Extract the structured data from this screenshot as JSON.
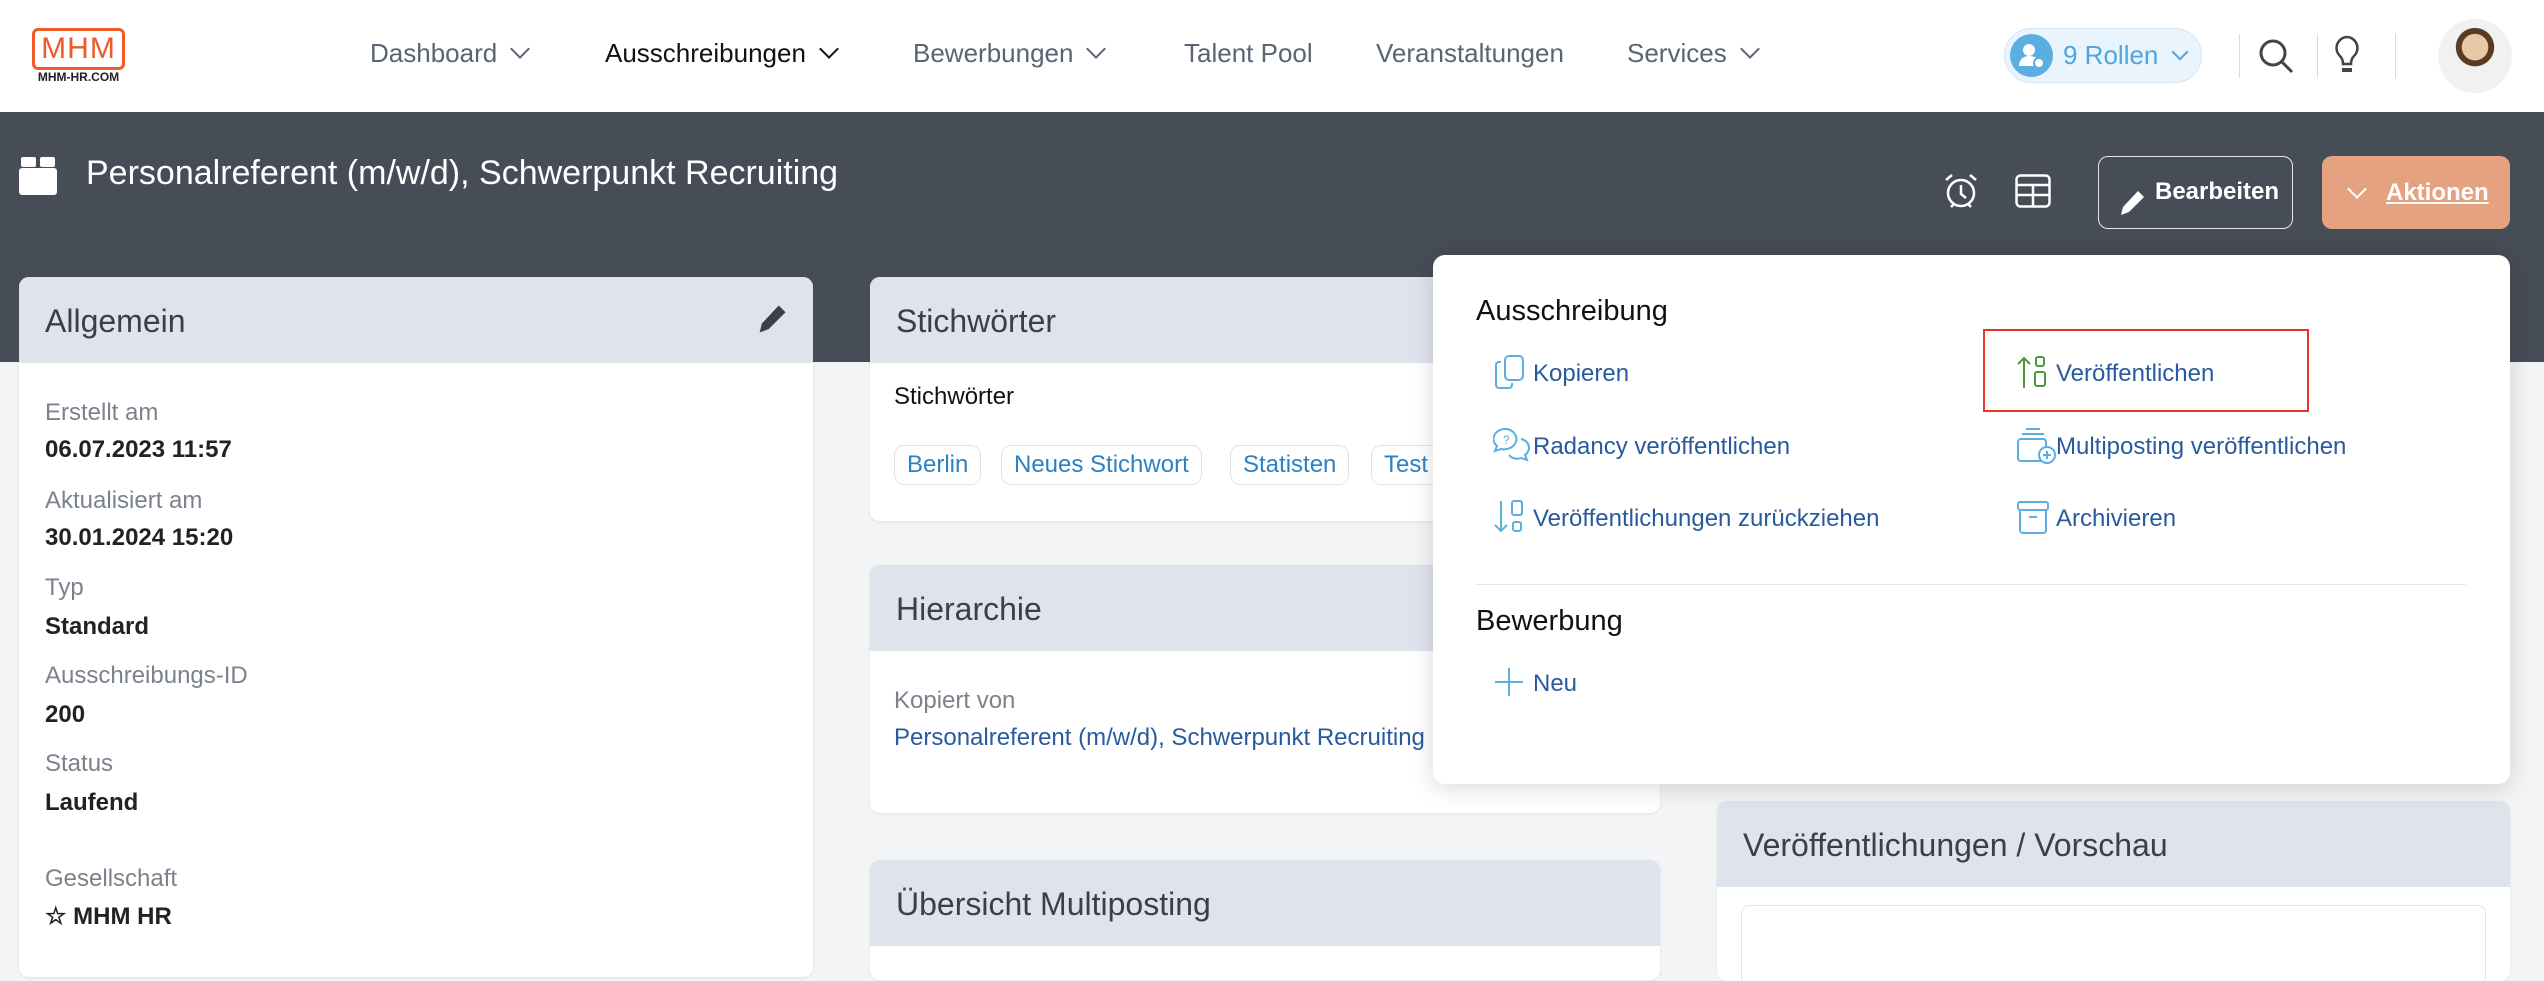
{
  "header": {
    "logo_text": "MHM",
    "logo_sub": "MHM-HR.COM",
    "nav": [
      {
        "label": "Dashboard",
        "dropdown": true
      },
      {
        "label": "Ausschreibungen",
        "dropdown": true,
        "active": true
      },
      {
        "label": "Bewerbungen",
        "dropdown": true
      },
      {
        "label": "Talent Pool"
      },
      {
        "label": "Veranstaltungen"
      },
      {
        "label": "Services",
        "dropdown": true
      }
    ],
    "roles_label": "9 Rollen",
    "icons": [
      "search-icon",
      "lightbulb-icon"
    ]
  },
  "page": {
    "title": "Personalreferent (m/w/d), Schwerpunkt Recruiting",
    "edit_label": "Bearbeiten",
    "actions_label": "Aktionen",
    "accent": "#e5a280"
  },
  "allgemein": {
    "title": "Allgemein",
    "fields": [
      {
        "label": "Erstellt am",
        "value": "06.07.2023 11:57"
      },
      {
        "label": "Aktualisiert am",
        "value": "30.01.2024 15:20"
      },
      {
        "label": "Typ",
        "value": "Standard"
      },
      {
        "label": "Ausschreibungs-ID",
        "value": "200"
      },
      {
        "label": "Status",
        "value": "Laufend"
      },
      {
        "label": "Gesellschaft",
        "value": "☆ MHM HR"
      }
    ]
  },
  "stichwoerter": {
    "title": "Stichwörter",
    "label": "Stichwörter",
    "tags": [
      "Berlin",
      "Neues Stichwort",
      "Statisten",
      "Test"
    ]
  },
  "hierarchie": {
    "title": "Hierarchie",
    "label": "Kopiert von",
    "link": "Personalreferent (m/w/d), Schwerpunkt Recruiting"
  },
  "multiposting": {
    "title": "Übersicht Multiposting"
  },
  "vorschau": {
    "title": "Veröffentlichungen / Vorschau"
  },
  "actions_menu": {
    "section1": "Ausschreibung",
    "items": [
      "Kopieren",
      "Veröffentlichen",
      "Radancy veröffentlichen",
      "Multiposting veröffentlichen",
      "Veröffentlichungen zurückziehen",
      "Archivieren"
    ],
    "section2": "Bewerbung",
    "new_label": "Neu",
    "highlighted": "Veröffentlichen"
  }
}
